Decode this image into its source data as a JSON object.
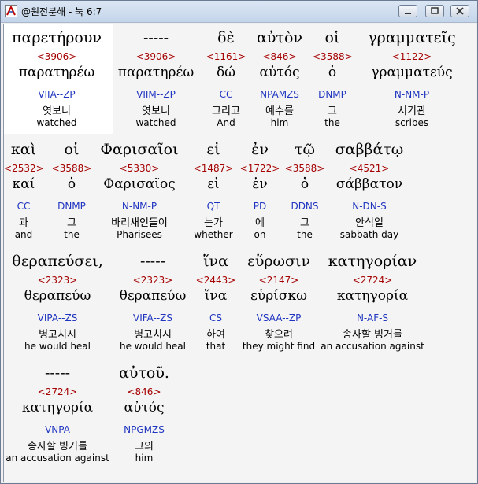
{
  "window": {
    "title": "@원전분해 - 눅 6:7"
  },
  "rows": [
    {
      "words": [
        {
          "greek": "παρετήρουν",
          "num": "<3906>",
          "lemma": "παρατηρέω",
          "parse": "VIIA--ZP",
          "kor": "엿보니",
          "eng": "watched"
        },
        {
          "greek": "-----",
          "num": "<3906>",
          "lemma": "παρατηρέω",
          "parse": "VIIM--ZP",
          "kor": "엿보니",
          "eng": "watched"
        },
        {
          "greek": "δὲ",
          "num": "<1161>",
          "lemma": "δώ",
          "parse": "CC",
          "kor": "그리고",
          "eng": "And"
        },
        {
          "greek": "αὐτὸν",
          "num": "<846>",
          "lemma": "αὐτός",
          "parse": "NPAMZS",
          "kor": "예수를",
          "eng": "him"
        },
        {
          "greek": "οἱ",
          "num": "<3588>",
          "lemma": "ὁ",
          "parse": "DNMP",
          "kor": "그",
          "eng": "the"
        },
        {
          "greek": "γραμματεῖς",
          "num": "<1122>",
          "lemma": "γραμματεύς",
          "parse": "N-NM-P",
          "kor": "서기관",
          "eng": "scribes"
        }
      ]
    },
    {
      "words": [
        {
          "greek": "καὶ",
          "num": "<2532>",
          "lemma": "καί",
          "parse": "CC",
          "kor": "과",
          "eng": "and"
        },
        {
          "greek": "οἱ",
          "num": "<3588>",
          "lemma": "ὁ",
          "parse": "DNMP",
          "kor": "그",
          "eng": "the"
        },
        {
          "greek": "Φαρισαῖοι",
          "num": "<5330>",
          "lemma": "Φαρισαῖος",
          "parse": "N-NM-P",
          "kor": "바리새인들이",
          "eng": "Pharisees"
        },
        {
          "greek": "εἰ",
          "num": "<1487>",
          "lemma": "εἰ",
          "parse": "QT",
          "kor": "는가",
          "eng": "whether"
        },
        {
          "greek": "ἐν",
          "num": "<1722>",
          "lemma": "ἐν",
          "parse": "PD",
          "kor": "에",
          "eng": "on"
        },
        {
          "greek": "τῷ",
          "num": "<3588>",
          "lemma": "ὁ",
          "parse": "DDNS",
          "kor": "그",
          "eng": "the"
        },
        {
          "greek": "σαββάτῳ",
          "num": "<4521>",
          "lemma": "σάββατον",
          "parse": "N-DN-S",
          "kor": "안식일",
          "eng": "sabbath day"
        }
      ]
    },
    {
      "words": [
        {
          "greek": "θεραπεύσει,",
          "num": "<2323>",
          "lemma": "θεραπεύω",
          "parse": "VIPA--ZS",
          "kor": "병고치시",
          "eng": "he would heal"
        },
        {
          "greek": "-----",
          "num": "<2323>",
          "lemma": "θεραπεύω",
          "parse": "VIFA--ZS",
          "kor": "병고치시",
          "eng": "he would heal"
        },
        {
          "greek": "ἵνα",
          "num": "<2443>",
          "lemma": "ἵνα",
          "parse": "CS",
          "kor": "하여",
          "eng": "that"
        },
        {
          "greek": "εὕρωσιν",
          "num": "<2147>",
          "lemma": "εὑρίσκω",
          "parse": "VSAA--ZP",
          "kor": "찾으려",
          "eng": "they might find"
        },
        {
          "greek": "κατηγορίαν",
          "num": "<2724>",
          "lemma": "κατηγορία",
          "parse": "N-AF-S",
          "kor": "송사할 빙거를",
          "eng": "an accusation against"
        }
      ]
    },
    {
      "words": [
        {
          "greek": "-----",
          "num": "<2724>",
          "lemma": "κατηγορία",
          "parse": "VNPA",
          "kor": "송사할 빙거를",
          "eng": "an accusation against"
        },
        {
          "greek": "αὐτοῦ.",
          "num": "<846>",
          "lemma": "αὐτός",
          "parse": "NPGMZS",
          "kor": "그의",
          "eng": "him"
        }
      ]
    }
  ]
}
